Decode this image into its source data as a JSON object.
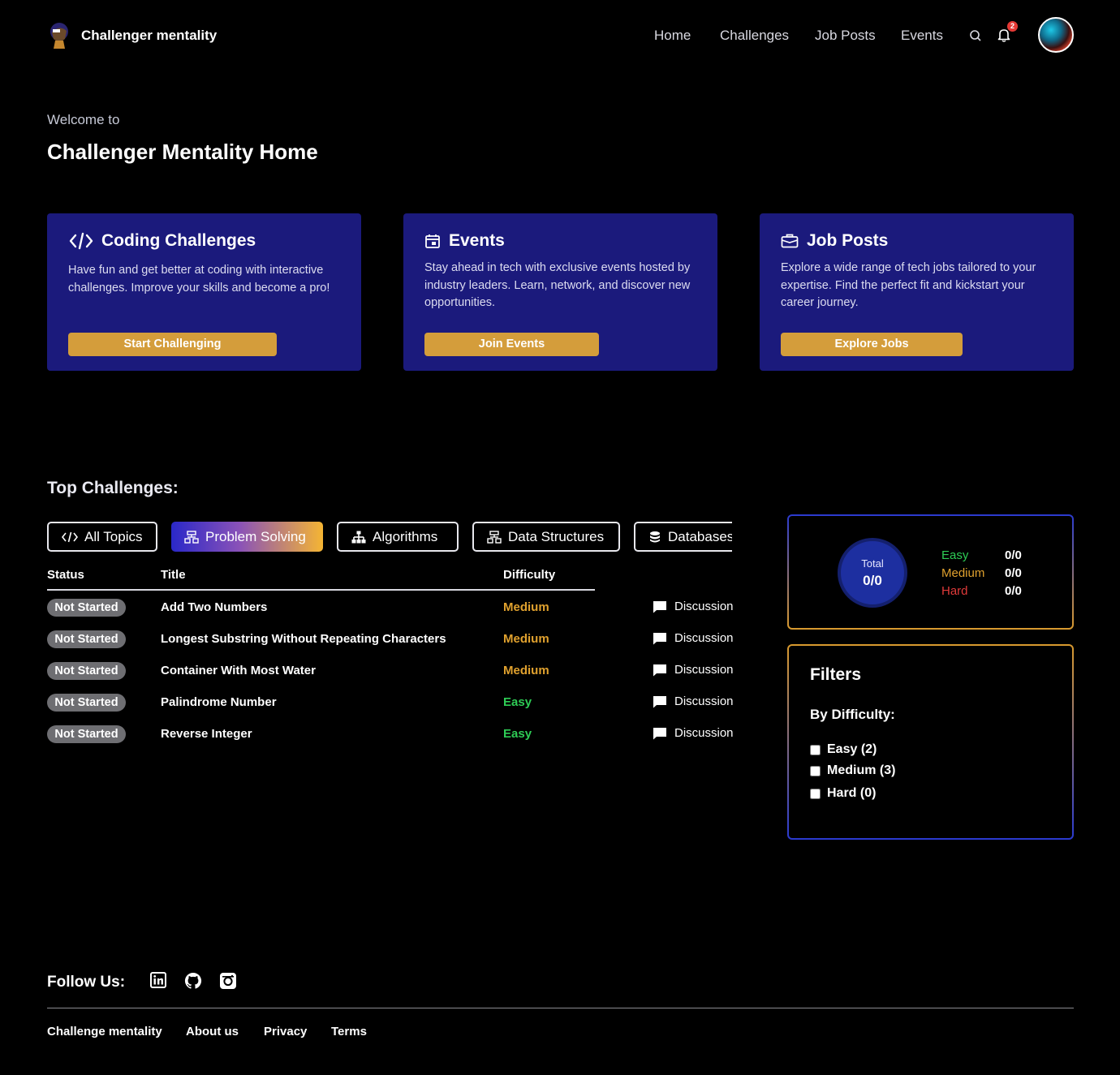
{
  "header": {
    "brand": "Challenger mentality",
    "nav": [
      "Home",
      "Challenges",
      "Job Posts",
      "Events"
    ],
    "notification_count": "2"
  },
  "welcome": {
    "subtitle": "Welcome to",
    "title": "Challenger Mentality Home"
  },
  "cards": [
    {
      "title": "Coding Challenges",
      "description": "Have fun and get better at coding with interactive challenges. Improve your skills and become a pro!",
      "button": "Start Challenging",
      "icon": "code-icon"
    },
    {
      "title": "Events",
      "description": "Stay ahead in tech with exclusive events hosted by industry leaders. Learn, network, and discover new opportunities.",
      "button": "Join Events",
      "icon": "calendar-icon"
    },
    {
      "title": "Job Posts",
      "description": "Explore a wide range of tech jobs tailored to your expertise. Find the perfect fit and kickstart your career journey.",
      "button": "Explore Jobs",
      "icon": "briefcase-icon"
    }
  ],
  "top_challenges": {
    "title": "Top Challenges:",
    "tabs": [
      "All Topics",
      "Problem Solving",
      "Algorithms",
      "Data Structures",
      "Databases"
    ],
    "active_tab": "Problem Solving",
    "columns": [
      "Status",
      "Title",
      "Difficulty"
    ],
    "rows": [
      {
        "status": "Not Started",
        "title": "Add Two Numbers",
        "difficulty": "Medium",
        "action": "Discussion"
      },
      {
        "status": "Not Started",
        "title": "Longest Substring Without Repeating Characters",
        "difficulty": "Medium",
        "action": "Discussion"
      },
      {
        "status": "Not Started",
        "title": "Container With Most Water",
        "difficulty": "Medium",
        "action": "Discussion"
      },
      {
        "status": "Not Started",
        "title": "Palindrome Number",
        "difficulty": "Easy",
        "action": "Discussion"
      },
      {
        "status": "Not Started",
        "title": "Reverse Integer",
        "difficulty": "Easy",
        "action": "Discussion"
      }
    ]
  },
  "stats": {
    "total_label": "Total",
    "total_value": "0/0",
    "easy_label": "Easy",
    "easy_value": "0/0",
    "medium_label": "Medium",
    "medium_value": "0/0",
    "hard_label": "Hard",
    "hard_value": "0/0"
  },
  "filters": {
    "title": "Filters",
    "subtitle": "By Difficulty:",
    "options": [
      "Easy (2)",
      "Medium (3)",
      "Hard (0)"
    ]
  },
  "footer": {
    "follow": "Follow Us:",
    "social_icons": [
      "linkedin-icon",
      "github-icon",
      "instagram-icon"
    ],
    "links": [
      "Challenge mentality",
      "About us",
      "Privacy",
      "Terms"
    ]
  },
  "colors": {
    "background": "#000000",
    "card": "#1b1a7c",
    "accent": "#d49d3b",
    "easy": "#2ecc55",
    "medium": "#e0a12e",
    "hard": "#e03a3a"
  }
}
